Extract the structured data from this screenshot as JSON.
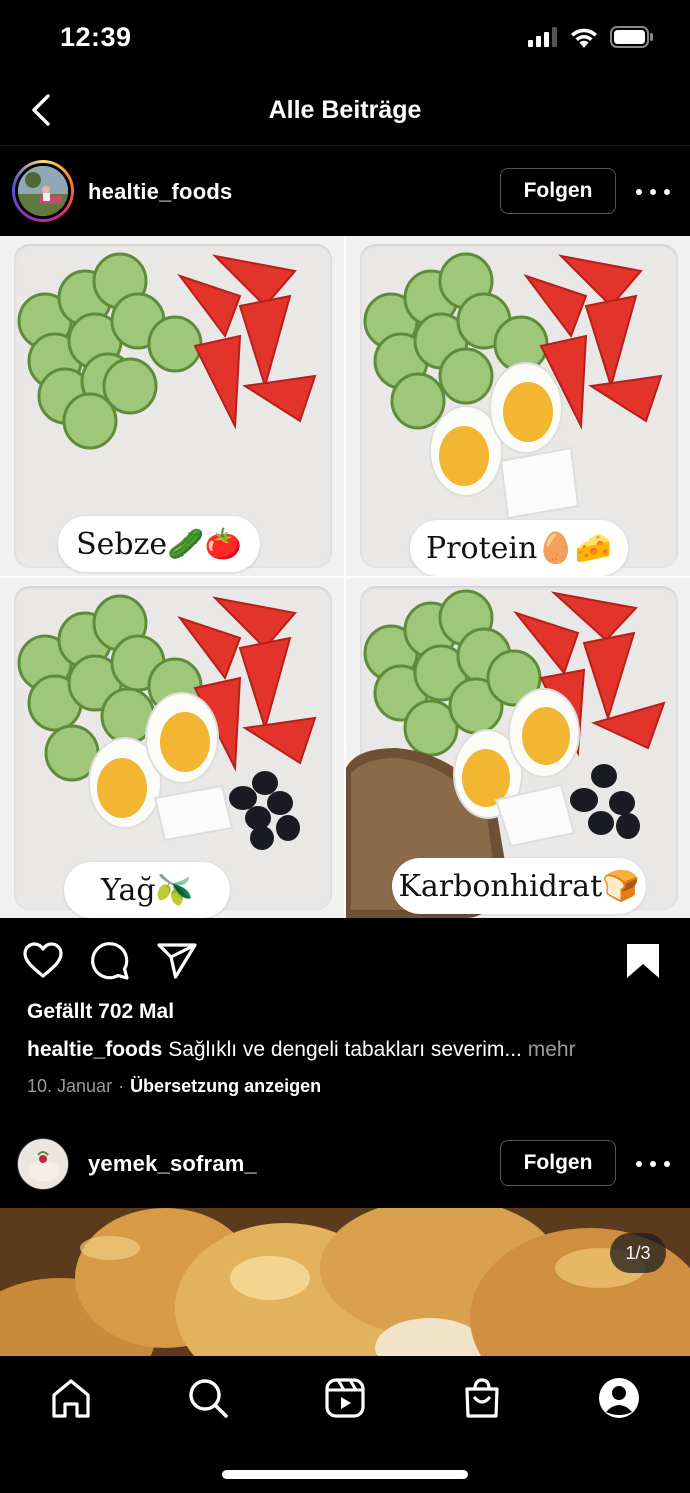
{
  "status_bar": {
    "time": "12:39"
  },
  "header": {
    "title": "Alle Beiträge"
  },
  "post1": {
    "username": "healtie_foods",
    "follow_label": "Folgen",
    "tiles": [
      {
        "label": "Sebze🥒🍅"
      },
      {
        "label": "Protein🥚🧀"
      },
      {
        "label": "Yağ🫒"
      },
      {
        "label": "Karbonhidrat🍞"
      }
    ],
    "likes": "Gefällt 702 Mal",
    "caption_user": "healtie_foods",
    "caption_text": " Sağlıklı ve dengeli tabakları severim...",
    "caption_more": " mehr",
    "date": "10. Januar",
    "separator": "·",
    "translate": "Übersetzung anzeigen"
  },
  "post2": {
    "username": "yemek_sofram_",
    "follow_label": "Folgen",
    "counter": "1/3"
  },
  "colors": {
    "background": "#000000",
    "muted": "#9a9a9a",
    "border": "#555555"
  },
  "icons": {
    "status": [
      "signal-icon",
      "wifi-icon",
      "battery-icon"
    ],
    "actions": [
      "heart-icon",
      "comment-icon",
      "share-icon",
      "bookmark-icon"
    ],
    "tabs": [
      "home-icon",
      "search-icon",
      "reels-icon",
      "shop-icon",
      "profile-icon"
    ]
  }
}
